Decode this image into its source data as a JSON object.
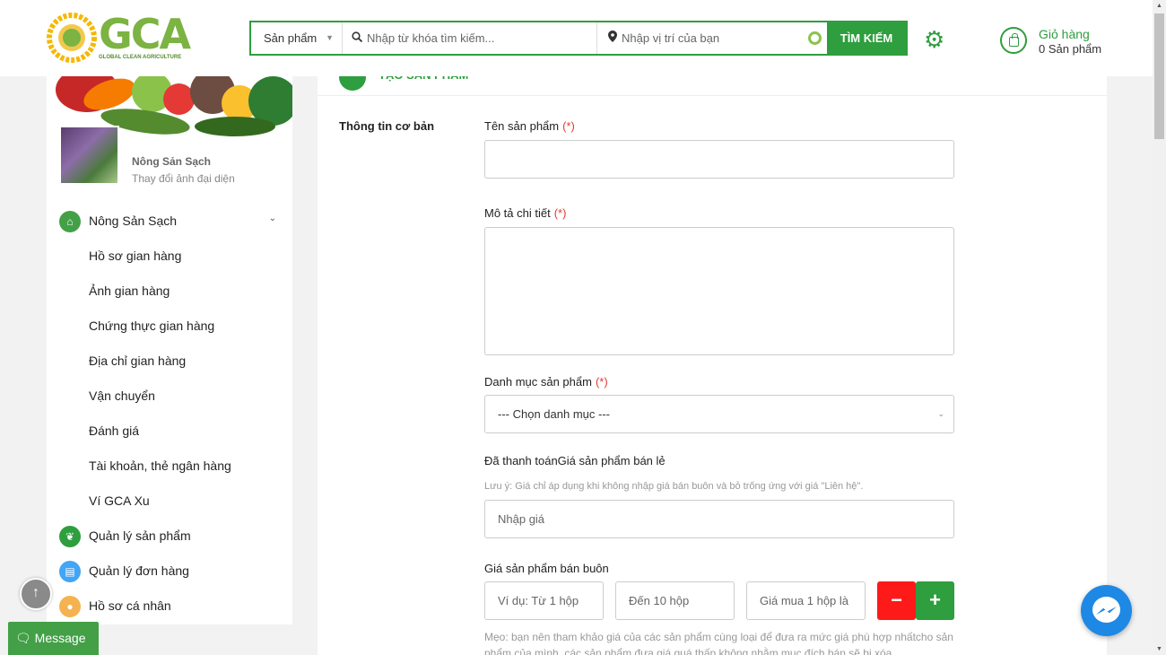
{
  "header": {
    "logo_text": "GCA",
    "logo_subtitle": "GLOBAL CLEAN AGRICULTURE",
    "search_category": "Sản phẩm",
    "search_placeholder": "Nhập từ khóa tìm kiếm...",
    "location_placeholder": "Nhập vị trí của bạn",
    "search_button": "TÌM KIẾM",
    "cart_title": "Giỏ hàng",
    "cart_count": "0 Sản phẩm"
  },
  "sidebar": {
    "shop_name": "Nông Sản Sạch",
    "change_avatar": "Thay đổi ảnh đại diện",
    "items": [
      {
        "label": "Nông Sản Sạch"
      },
      {
        "label": "Hồ sơ gian hàng"
      },
      {
        "label": "Ảnh gian hàng"
      },
      {
        "label": "Chứng thực gian hàng"
      },
      {
        "label": "Địa chỉ gian hàng"
      },
      {
        "label": "Vận chuyển"
      },
      {
        "label": "Đánh giá"
      },
      {
        "label": "Tài khoản, thẻ ngân hàng"
      },
      {
        "label": "Ví GCA Xu"
      },
      {
        "label": "Quản lý sản phẩm"
      },
      {
        "label": "Quản lý đơn hàng"
      },
      {
        "label": "Hồ sơ cá nhân"
      }
    ]
  },
  "form": {
    "tab_title": "TẠO SẢN PHẨM",
    "section_label": "Thông tin cơ bản",
    "required_mark": "(*)",
    "name_label": "Tên sản phẩm",
    "desc_label": "Mô tả chi tiết",
    "category_label": "Danh mục sản phẩm",
    "category_placeholder": "--- Chọn danh mục ---",
    "retail_label": "Đã thanh toánGiá sản phẩm bán lẻ",
    "retail_note": "Lưu ý: Giá chỉ áp dụng khi không nhập giá bán buôn và bỏ trống ứng với giá \"Liên hệ\".",
    "retail_placeholder": "Nhập giá",
    "wholesale_label": "Giá sản phẩm bán buôn",
    "from_placeholder": "Ví dụ: Từ 1 hộp",
    "to_placeholder": "Đến 10 hộp",
    "price_placeholder": "Giá mua 1 hộp là",
    "minus": "−",
    "plus": "+",
    "tip": "Mẹo: bạn nên tham khảo giá của các sản phẩm cùng loại để đưa ra mức giá phù hợp nhấtcho sản phẩm của mình, các sản phẩm đưa giá quá thấp không nhằm mục đích bán sẽ bị xóa."
  },
  "floating": {
    "message_button": "Message"
  },
  "colors": {
    "brand_green": "#2e9e3e",
    "danger_red": "#ff1a1a",
    "messenger_blue": "#1e88e5"
  }
}
